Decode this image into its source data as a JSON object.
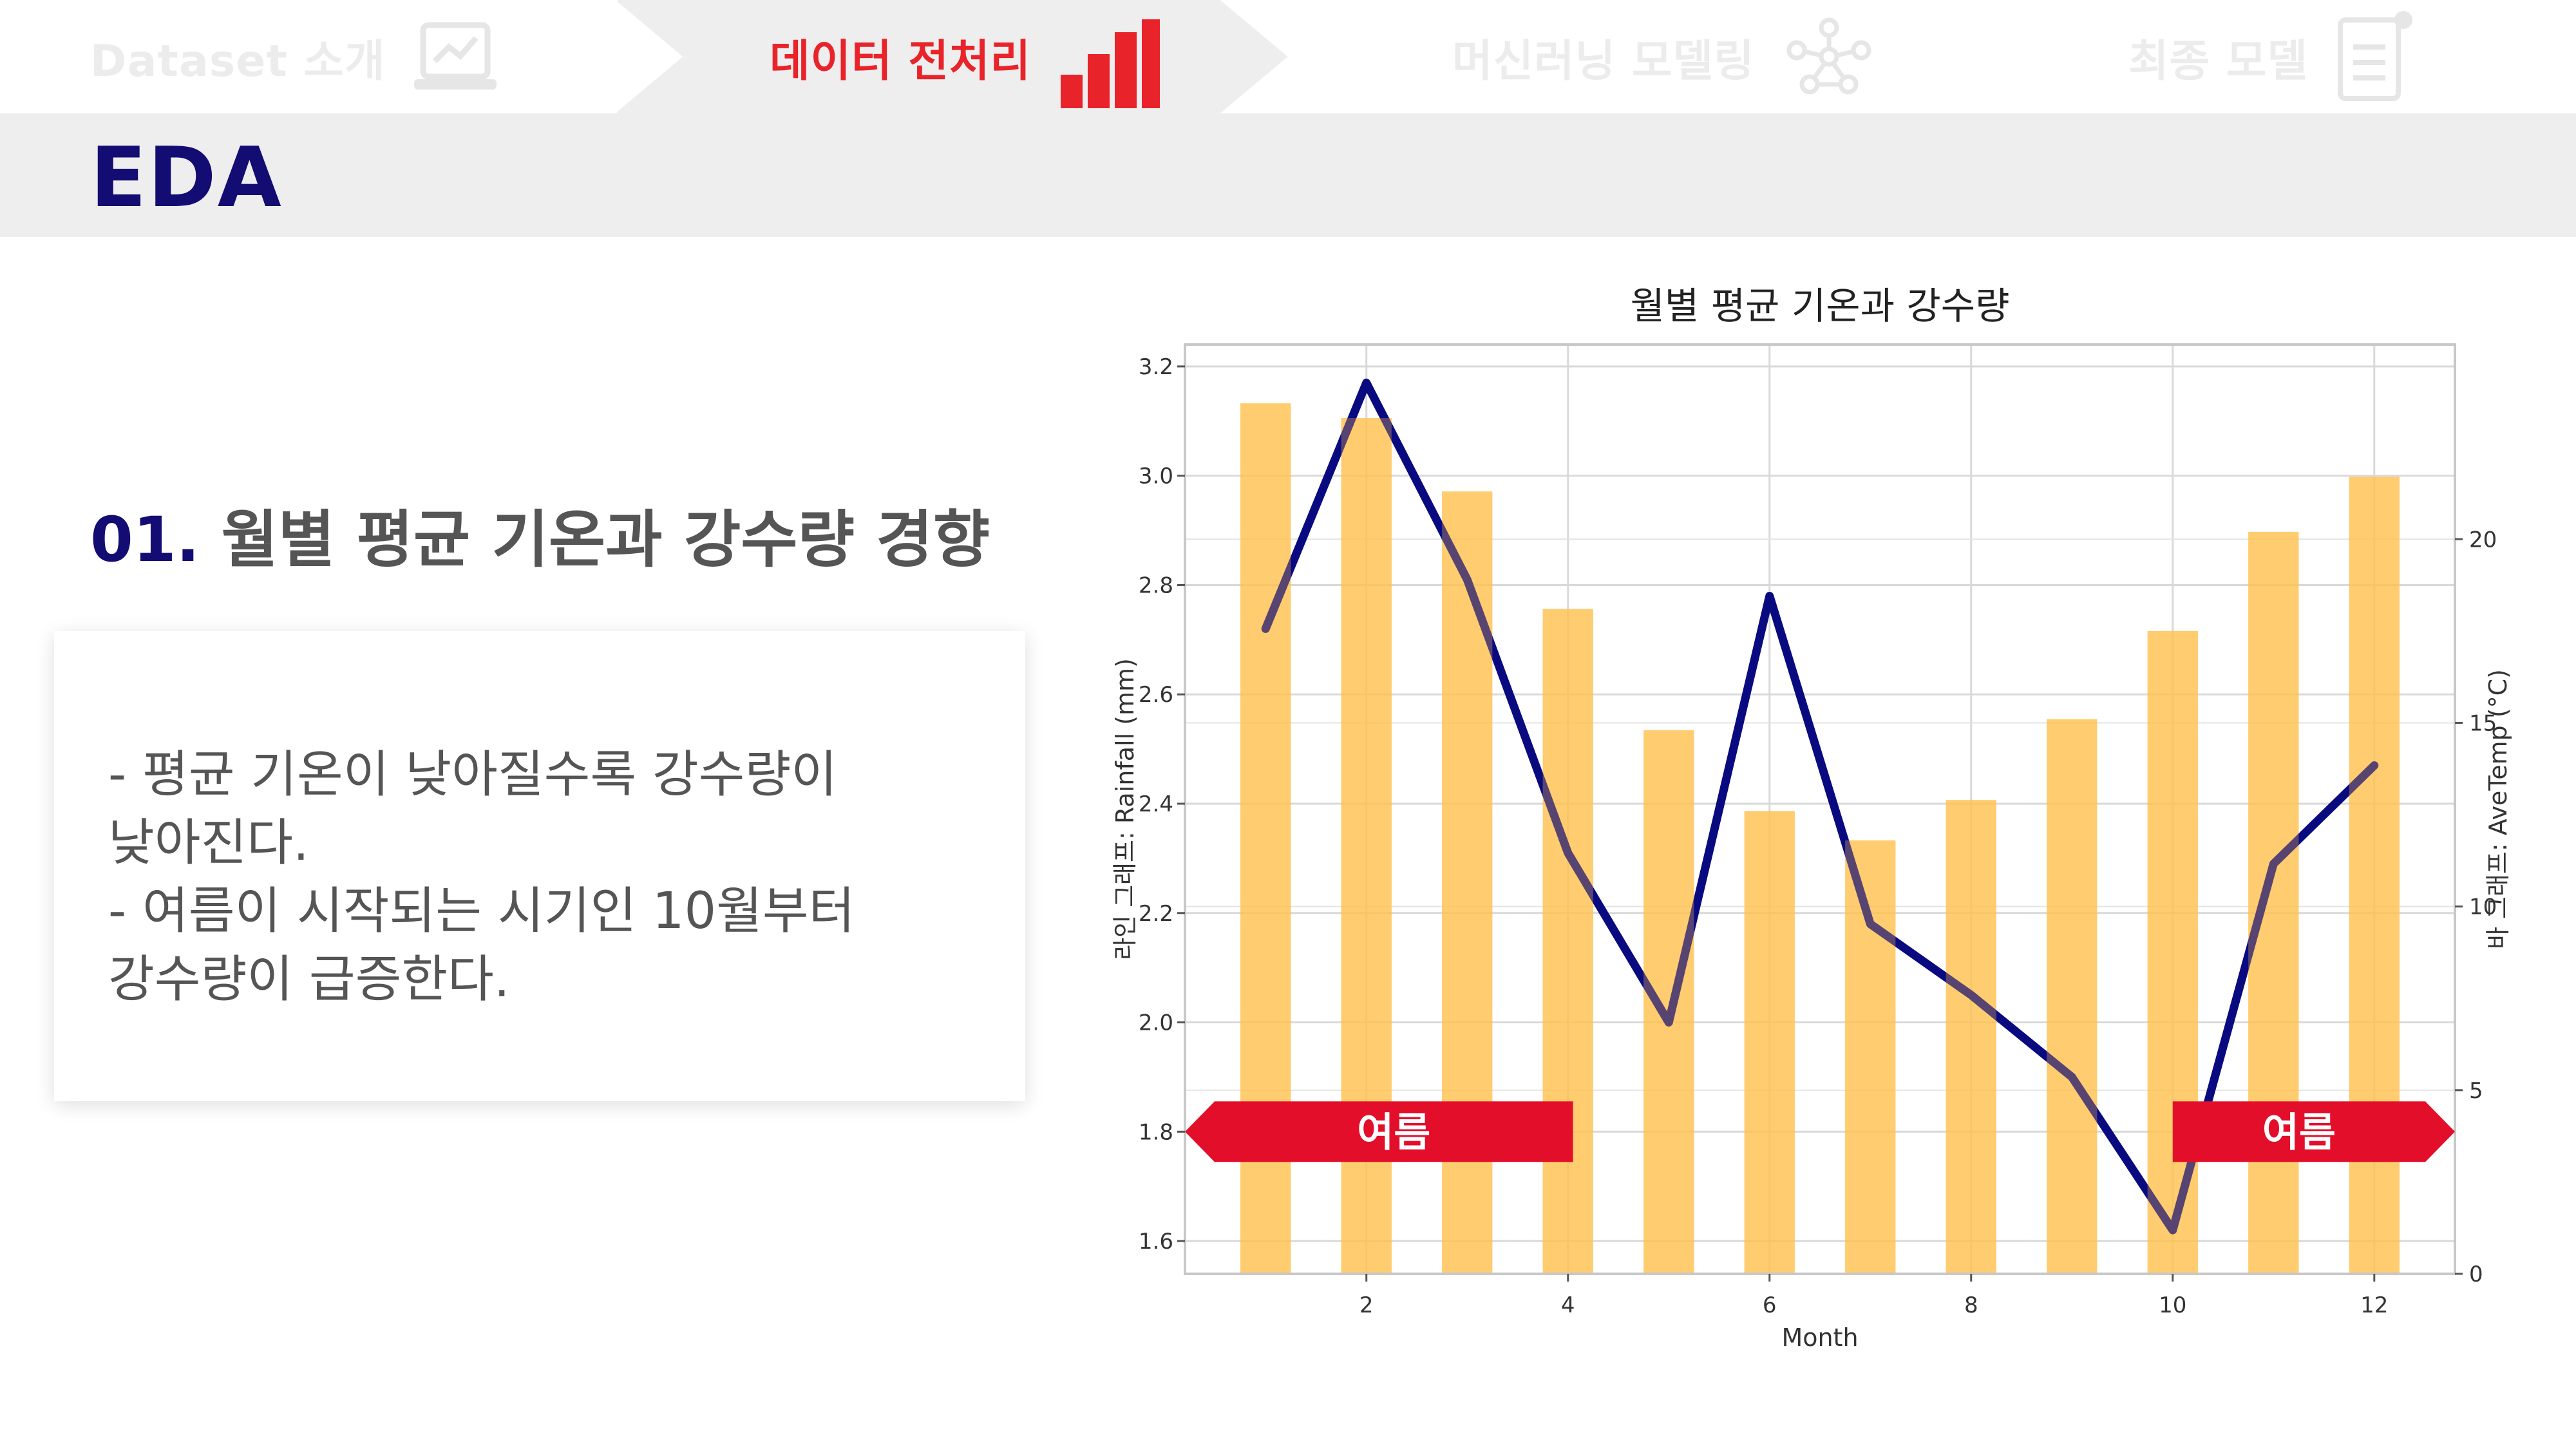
{
  "nav": {
    "steps": [
      {
        "label": "Dataset 소개",
        "state": "done",
        "icon": "laptop-chart-icon"
      },
      {
        "label": "데이터 전처리",
        "state": "active",
        "icon": "bar-chart-icon"
      },
      {
        "label": "머신러닝 모델링",
        "state": "upcoming",
        "icon": "network-icon"
      },
      {
        "label": "최종 모델",
        "state": "upcoming",
        "icon": "document-icon"
      }
    ],
    "active_color": "#e8232a",
    "dim_color": "#ececec"
  },
  "section": {
    "title": "EDA"
  },
  "content": {
    "subtitle_number": "01.",
    "subtitle_text": "월별 평균 기온과 강수량 경향",
    "lines": [
      "- 평균 기온이 낮아질수록 강수량이",
      "낮아진다.",
      "- 여름이 시작되는 시기인 10월부터",
      "강수량이 급증한다."
    ]
  },
  "chart_data": {
    "type": "bar",
    "title": "월별 평균 기온과 강수량",
    "xlabel": "Month",
    "ylabel_left": "라인 그래프: Rainfall (mm)",
    "ylabel_right": "바 그래프: AveTemp (°C)",
    "x": [
      1,
      2,
      3,
      4,
      5,
      6,
      7,
      8,
      9,
      10,
      11,
      12
    ],
    "xticks": [
      2,
      4,
      6,
      8,
      10,
      12
    ],
    "xlim": [
      0.2,
      12.8
    ],
    "grid": true,
    "series": [
      {
        "kind": "line",
        "axis": "left",
        "color": "#0a0a80",
        "values": [
          2.72,
          3.17,
          2.81,
          2.31,
          2.0,
          2.78,
          2.18,
          2.05,
          1.9,
          1.62,
          2.29,
          2.47
        ]
      },
      {
        "kind": "bar",
        "axis": "right",
        "color": "#ffc04d",
        "values": [
          23.7,
          23.3,
          21.3,
          18.1,
          14.8,
          12.6,
          11.8,
          12.9,
          15.1,
          17.5,
          20.2,
          21.7
        ]
      }
    ],
    "ylim_left": [
      1.54,
      3.24
    ],
    "yticks_left": [
      "1.6",
      "1.8",
      "2.0",
      "2.2",
      "2.4",
      "2.6",
      "2.8",
      "3.0",
      "3.2"
    ],
    "ylim_right": [
      0,
      25.3
    ],
    "yticks_right": [
      "0",
      "5",
      "10",
      "15",
      "20"
    ],
    "annotations": [
      {
        "text": "여름",
        "color": "#e30e2a",
        "x_from": 0.2,
        "x_to": 4.05,
        "y": 1.8,
        "direction": "left"
      },
      {
        "text": "여름",
        "color": "#e30e2a",
        "x_from": 10.0,
        "x_to": 12.8,
        "y": 1.8,
        "direction": "right"
      }
    ]
  }
}
